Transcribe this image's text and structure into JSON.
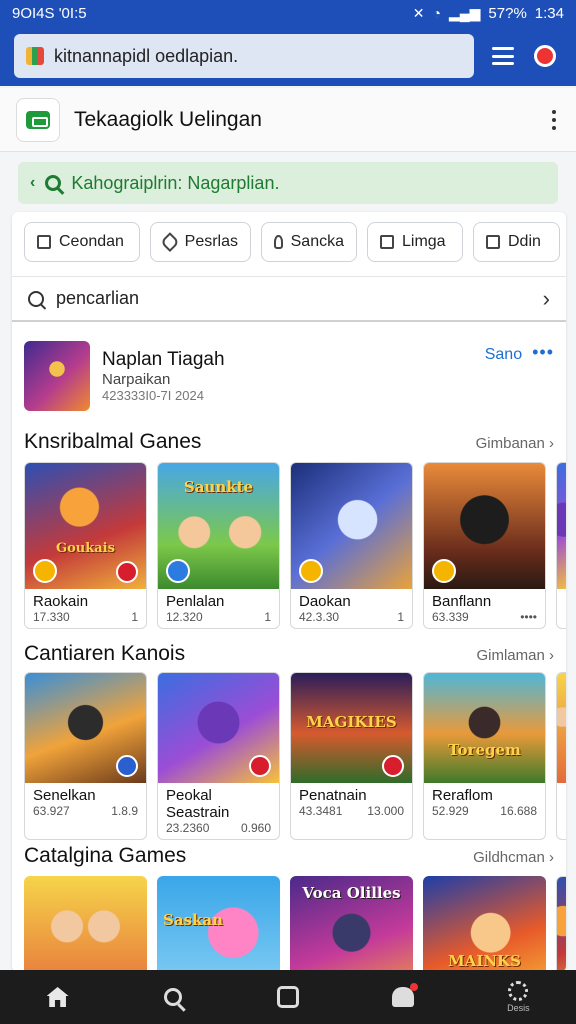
{
  "status": {
    "left": "9OI4S '0I:5",
    "battery": "57?%",
    "time": "1:34"
  },
  "browser": {
    "url": "kitnannapidl oedlapian."
  },
  "app": {
    "title": "Tekaagiolk Uelingan"
  },
  "banner": {
    "text": "Kahograiplrin: Nagarplian."
  },
  "chips": [
    {
      "label": "Ceondan"
    },
    {
      "label": "Pesrlas"
    },
    {
      "label": "Sancka"
    },
    {
      "label": "Limga"
    },
    {
      "label": "Ddin"
    }
  ],
  "search": {
    "value": "pencarlian"
  },
  "featured": {
    "title": "Naplan Tiagah",
    "subtitle": "Narpaikan",
    "date": "423333I0-7I 2024",
    "action": "Sano"
  },
  "sections": [
    {
      "title": "Knsribalmal Ganes",
      "link": "Gimbanan",
      "cards": [
        {
          "name": "Raokain",
          "meta": "17.330",
          "meta_r": "1",
          "art_title": "Goukais"
        },
        {
          "name": "Penlalan",
          "meta": "12.320",
          "meta_r": "1",
          "art_title": "Saunkte"
        },
        {
          "name": "Daokan",
          "meta": "42.3.30",
          "meta_r": "1",
          "art_title": ""
        },
        {
          "name": "Banflann",
          "meta": "63.339",
          "meta_r": "••••",
          "art_title": ""
        }
      ]
    },
    {
      "title": "Cantiaren Kanois",
      "link": "Gimlaman",
      "cards": [
        {
          "name": "Senelkan",
          "meta": "63.927",
          "meta_r": "1.8.9",
          "art_title": ""
        },
        {
          "name": "Peokal Seastrain",
          "meta": "23.2360",
          "meta_r": "0.960",
          "art_title": ""
        },
        {
          "name": "Penatnain",
          "meta": "43.3481",
          "meta_r": "13.000",
          "art_title": "MAGIKIES"
        },
        {
          "name": "Reraflom",
          "meta": "52.929",
          "meta_r": "16.688",
          "art_title": "Toregem"
        }
      ]
    },
    {
      "title": "Catalgina Games",
      "link": "Gildhcman",
      "cards": [
        {
          "name": "",
          "meta": "",
          "meta_r": "",
          "art_title": ""
        },
        {
          "name": "",
          "meta": "",
          "meta_r": "",
          "art_title": "Saskan"
        },
        {
          "name": "",
          "meta": "",
          "meta_r": "",
          "art_title": "Voca Olilles"
        },
        {
          "name": "",
          "meta": "",
          "meta_r": "",
          "art_title": "MAINKS"
        }
      ]
    }
  ],
  "nav": [
    {
      "icon": "home-icon"
    },
    {
      "icon": "search-icon"
    },
    {
      "icon": "square-icon"
    },
    {
      "icon": "notification-icon"
    },
    {
      "icon": "settings-icon",
      "label": "Desis"
    }
  ],
  "colors": {
    "primary": "#1e4fb8",
    "accent": "#1e6fd1",
    "banner_bg": "#dcefdc",
    "banner_text": "#1f7a32",
    "nav_bg": "#1c1c1c"
  }
}
